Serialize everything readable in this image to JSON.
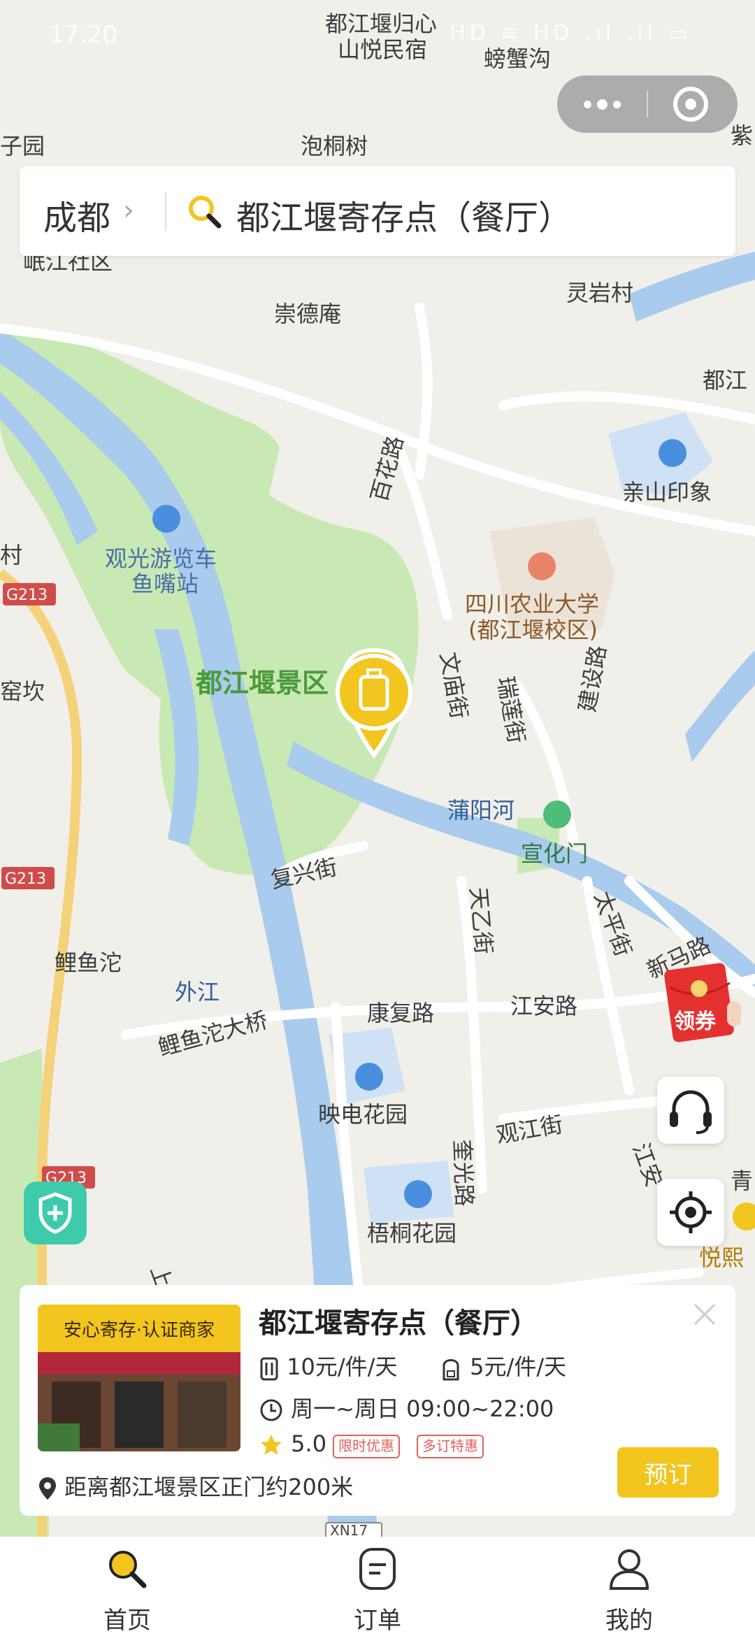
{
  "status_bar": {
    "time": "17:20",
    "indicators": "HD ≋ HD .ıl .ıl ▭"
  },
  "capsule": {
    "more_icon": "more-dots-icon",
    "close_icon": "close-circle-icon"
  },
  "search": {
    "city": "成都",
    "query": "都江堰寄存点（餐厅）"
  },
  "map": {
    "labels": {
      "guixin": "都江堰归心",
      "shanyue": "山悦民宿",
      "pangxiegou": "螃蟹沟",
      "ziyuan": "子园",
      "paotongshu": "泡桐树",
      "zi": "紫",
      "minjiang": "岷江社区",
      "chongdean": "崇德庵",
      "lingyancun": "灵岩村",
      "dujiang_right": "都江",
      "baihua": "百花路",
      "qinshan": "亲山印象",
      "guanguang1": "观光游览车",
      "guanguang2": "鱼嘴站",
      "cun": "村",
      "sichuan1": "四川农业大学",
      "sichuan2": "(都江堰校区)",
      "jingqu": "都江堰景区",
      "wenmiao": "文庙街",
      "ruilian": "瑞莲街",
      "jianshe": "建设路",
      "yaokan": "窑坎",
      "puyang": "蒲阳河",
      "xuanhua": "宣化门",
      "fuxing": "复兴街",
      "tianyi": "天乙街",
      "taiping": "太平街",
      "xinma": "新马路",
      "liyutuo": "鲤鱼沱",
      "waijiang": "外江",
      "kangfu": "康复路",
      "jiangan": "江安路",
      "daqiao": "鲤鱼沱大桥",
      "yingdian": "映电花园",
      "kuiguang": "奎光路",
      "guanjiang": "观江街",
      "jiangan2": "江安",
      "qing": "青",
      "wutong": "梧桐花园",
      "yuexi": "悦熙",
      "shang": "上",
      "g213": "G213",
      "xn17": "XN17"
    }
  },
  "store": {
    "tag": "安心寄存·认证商家",
    "name": "都江堰寄存点（餐厅）",
    "large_price": "10元/件/天",
    "small_price": "5元/件/天",
    "hours": "周一~周日 09:00~22:00",
    "rating": "5.0",
    "badge1": "限时优惠",
    "badge2": "多订特惠",
    "distance": "距离都江堰景区正门约200米",
    "book": "预订"
  },
  "coupon": {
    "label": "领券"
  },
  "tabs": {
    "home": "首页",
    "orders": "订单",
    "mine": "我的"
  },
  "colors": {
    "accent": "#f2c51f",
    "river": "#a9cbed",
    "park": "#c9e9b4",
    "shield": "#3ecbab"
  }
}
